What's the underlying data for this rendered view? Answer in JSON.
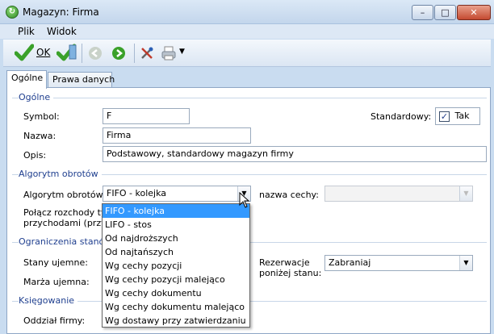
{
  "window": {
    "title": "Magazyn: Firma",
    "icon_glyph": "↻",
    "buttons": {
      "minimize": "–",
      "maximize": "□",
      "close": "✕"
    }
  },
  "menu": {
    "items": [
      "Plik",
      "Widok"
    ]
  },
  "toolbar": {
    "ok_label": "OK",
    "icons": [
      "checkmark-icon",
      "check-edit-icon",
      "nav-back-icon",
      "nav-forward-icon",
      "tools-icon",
      "printer-icon",
      "dropdown-arrow-icon"
    ]
  },
  "tabs": [
    "Ogólne",
    "Prawa danych"
  ],
  "general": {
    "section_title": "Ogólne",
    "symbol_label": "Symbol:",
    "symbol_value": "F",
    "standard_label": "Standardowy:",
    "standard_checkbox_label": "Tak",
    "standard_checked": true,
    "name_label": "Nazwa:",
    "name_value": "Firma",
    "desc_label": "Opis:",
    "desc_value": "Podstawowy, standardowy magazyn firmy"
  },
  "turnover": {
    "section_title": "Algorytm obrotów",
    "algorithm_label": "Algorytm obrotów:",
    "algorithm_value": "FIFO - kolejka",
    "feature_label": "nazwa cechy:",
    "merge_label_1": "Połącz rozchody tyl",
    "merge_label_2": "przychodami (przyc"
  },
  "limits": {
    "section_title": "Ograniczenia stanów",
    "negative_stock_label": "Stany ujemne:",
    "negative_margin_label": "Marża ujemna:",
    "reservation_label_1": "Rezerwacje",
    "reservation_label_2": "poniżej stanu:",
    "reservation_value": "Zabraniaj"
  },
  "accounting": {
    "section_title": "Księgowanie",
    "branch_label": "Oddział firmy:"
  },
  "dropdown": {
    "options": [
      "FIFO - kolejka",
      "LIFO - stos",
      "Od najdroższych",
      "Od najtańszych",
      "Wg cechy pozycji",
      "Wg cechy pozycji malejąco",
      "Wg cechy dokumentu",
      "Wg cechy dokumentu malejąco",
      "Wg dostawy przy zatwierdzaniu"
    ],
    "selected_index": 0
  },
  "colors": {
    "accent": "#3399ff",
    "group_title": "#1f3f8f",
    "ok_green": "#3aa12a"
  }
}
